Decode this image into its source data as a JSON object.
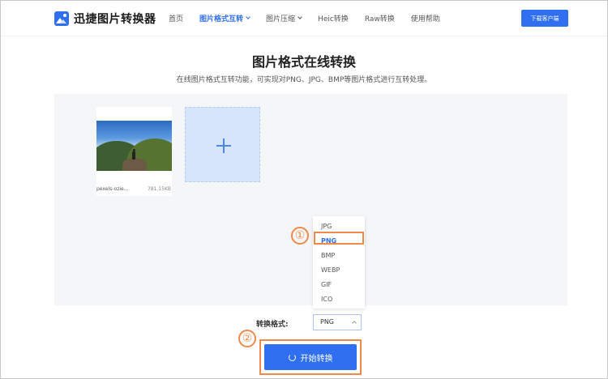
{
  "header": {
    "logo_text": "迅捷图片转换器",
    "nav": [
      {
        "label": "首页",
        "active": false,
        "has_dropdown": false
      },
      {
        "label": "图片格式互转",
        "active": true,
        "has_dropdown": true
      },
      {
        "label": "图片压缩",
        "active": false,
        "has_dropdown": true
      },
      {
        "label": "Heic转换",
        "active": false,
        "has_dropdown": false
      },
      {
        "label": "Raw转换",
        "active": false,
        "has_dropdown": false
      },
      {
        "label": "使用帮助",
        "active": false,
        "has_dropdown": false
      }
    ],
    "download_label": "下载客户端"
  },
  "main": {
    "title": "图片格式在线转换",
    "subtitle": "在线图片格式互转功能，可实现对PNG、JPG、BMP等图片格式进行互转处理。",
    "file": {
      "name": "pexels-ozie...",
      "size": "781.15KB"
    },
    "format_options": [
      "JPG",
      "PNG",
      "BMP",
      "WEBP",
      "GIF",
      "ICO"
    ],
    "selected_format": "PNG",
    "format_label": "转换格式:",
    "start_label": "开始转换",
    "markers": [
      "①",
      "②"
    ]
  },
  "colors": {
    "accent": "#2f6ff0",
    "highlight": "#f08a4b",
    "work_bg": "#f5f6f8"
  }
}
